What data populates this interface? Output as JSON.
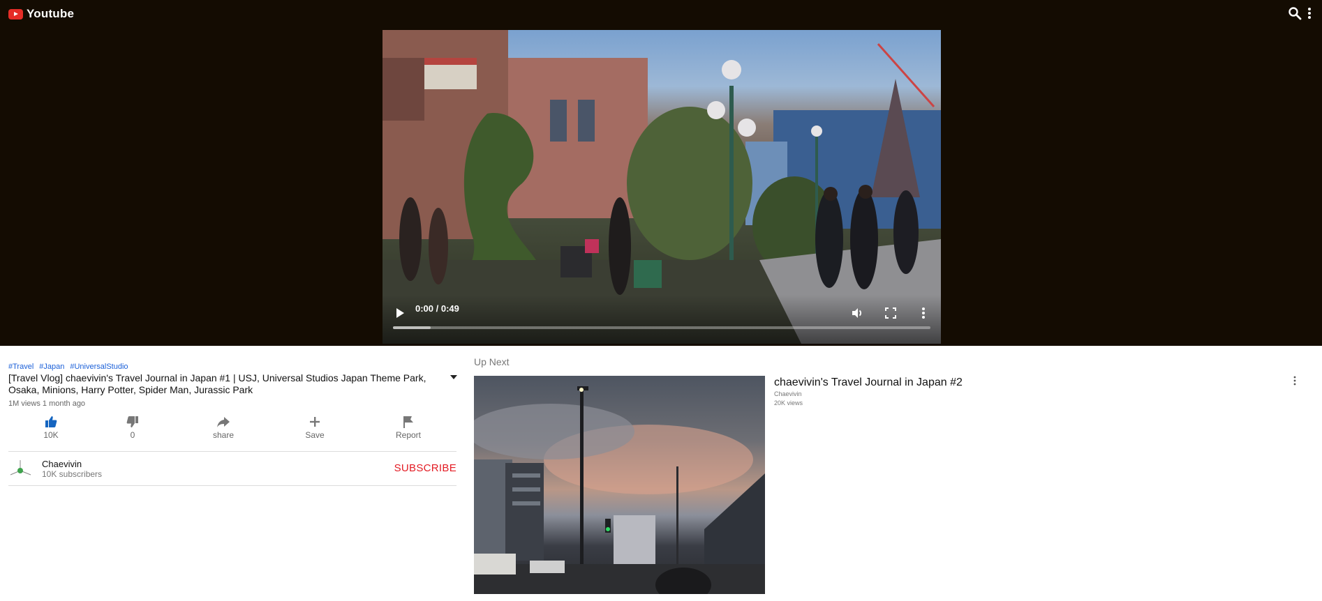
{
  "header": {
    "logo_text": "Youtube",
    "search_icon": "search-icon",
    "more_icon": "more-vert-icon"
  },
  "player": {
    "time_display": "0:00 / 0:49",
    "buffered_fraction": 0.07,
    "controls": [
      "play-icon",
      "volume-icon",
      "fullscreen-icon",
      "more-vert-icon"
    ]
  },
  "video": {
    "tags": [
      "#Travel",
      "#Japan",
      "#UniversalStudio"
    ],
    "title": "[Travel Vlog] chaevivin's Travel Journal in Japan #1 | USJ, Universal Studios Japan Theme Park, Osaka, Minions, Harry Potter, Spider Man, Jurassic Park",
    "meta": "1M views 1 month ago",
    "actions": {
      "like": "10K",
      "dislike": "0",
      "share": "share",
      "save": "Save",
      "report": "Report"
    }
  },
  "channel": {
    "name": "Chaevivin",
    "subscribers": "10K subscribers",
    "subscribe_label": "SUBSCRIBE"
  },
  "up_next": {
    "label": "Up Next",
    "items": [
      {
        "title": "chaevivin's Travel Journal in Japan #2",
        "channel": "Chaevivin",
        "views": "20K views"
      }
    ]
  },
  "colors": {
    "header_bg": "#140c02",
    "accent_red": "#e31b23",
    "link_blue": "#1a5fd8",
    "like_active": "#1565c0"
  }
}
